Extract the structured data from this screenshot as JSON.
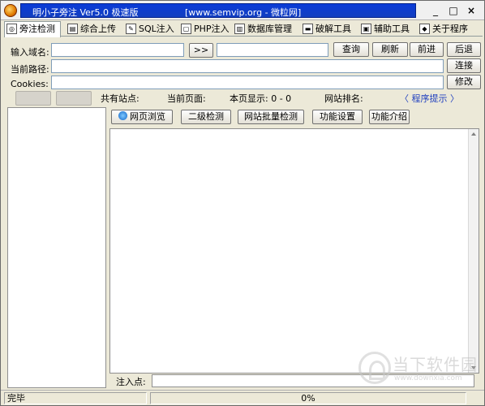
{
  "window": {
    "title": "明小子旁注 Ver5.0 极速版",
    "url_label": "[www.semvip.org - 微粒网]",
    "min": "_",
    "max": "□",
    "close": "×"
  },
  "tabs": [
    {
      "label": "旁注检测",
      "icon": "scan-icon"
    },
    {
      "label": "综合上传",
      "icon": "upload-icon"
    },
    {
      "label": "SQL注入",
      "icon": "sql-icon"
    },
    {
      "label": "PHP注入",
      "icon": "php-icon"
    },
    {
      "label": "数据库管理",
      "icon": "database-icon"
    },
    {
      "label": "破解工具",
      "icon": "crack-icon"
    },
    {
      "label": "辅助工具",
      "icon": "tools-icon"
    },
    {
      "label": "关于程序",
      "icon": "about-icon"
    }
  ],
  "form": {
    "domain_label": "输入域名:",
    "domain_value": "",
    "go_button": ">>",
    "extra_value": "",
    "path_label": "当前路径:",
    "path_value": "",
    "cookies_label": "Cookies:",
    "cookies_value": ""
  },
  "buttons": {
    "query": "查询",
    "refresh": "刷新",
    "forward": "前进",
    "back": "后退",
    "connect": "连接",
    "modify": "修改"
  },
  "info": {
    "total_sites": "共有站点:",
    "current_page": "当前页面:",
    "page_display": "本页显示: 0 - 0",
    "site_rank": "网站排名:",
    "hint": "〈 程序提示 〉"
  },
  "subtabs": [
    "网页浏览",
    "二级检测",
    "网站批量检测",
    "功能设置",
    "功能介绍"
  ],
  "inject_label": "注入点:",
  "status": {
    "text": "完毕",
    "progress": "0%"
  },
  "watermark": {
    "name": "当下软件园",
    "url": "www.downxia.com"
  }
}
